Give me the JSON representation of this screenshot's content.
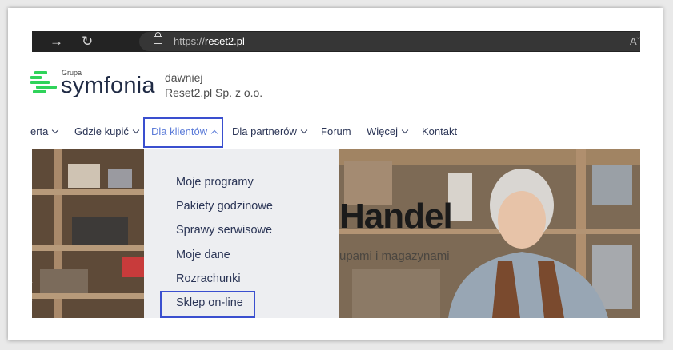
{
  "browser": {
    "url_prefix": "https://",
    "url_domain": "reset2.pl",
    "reader_label": "Aˇ",
    "forward_icon": "→",
    "refresh_icon": "↻",
    "icons": [
      "forward-arrow-icon",
      "refresh-icon",
      "lock-icon",
      "reader-mode-icon"
    ]
  },
  "brand": {
    "small_label": "Grupa",
    "name": "symfonia",
    "tagline_line1": "dawniej",
    "tagline_line2": "Reset2.pl Sp. z o.o.",
    "accent_color": "#2fd35a"
  },
  "nav": {
    "items": [
      {
        "label": "erta",
        "has_dropdown": true
      },
      {
        "label": "Gdzie kupić",
        "has_dropdown": true
      },
      {
        "label": "Dla klientów",
        "has_dropdown": true,
        "expanded": true
      },
      {
        "label": "Dla partnerów",
        "has_dropdown": true
      },
      {
        "label": "Forum",
        "has_dropdown": false
      },
      {
        "label": "Więcej",
        "has_dropdown": true
      },
      {
        "label": "Kontakt",
        "has_dropdown": false
      }
    ],
    "highlight_color": "#3a4fcf"
  },
  "dropdown": {
    "items": [
      {
        "label": "Moje programy"
      },
      {
        "label": "Pakiety godzinowe"
      },
      {
        "label": "Sprawy serwisowe"
      },
      {
        "label": "Moje dane"
      },
      {
        "label": "Rozrachunki"
      },
      {
        "label": "Sklep on-line",
        "highlighted": true
      }
    ]
  },
  "hero": {
    "title": "Handel",
    "subtitle": "upami i magazynami"
  }
}
